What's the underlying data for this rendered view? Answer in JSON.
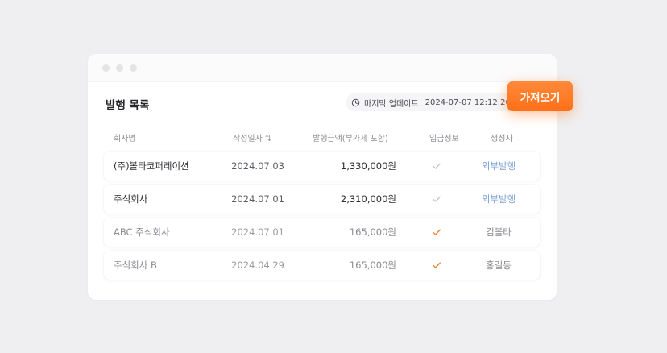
{
  "window": {
    "heading": "발행 목록",
    "last_update_label": "마지막 업데이트",
    "last_update_time": "2024-07-07 12:12:20"
  },
  "columns": {
    "company": "회사명",
    "date": "작성일자",
    "amount": "발행금액(부가세 포함)",
    "deposit": "입금정보",
    "creator": "생성자"
  },
  "rows": [
    {
      "company": "(주)볼타코퍼레이션",
      "date": "2024.07.03",
      "amount": "1,330,000원",
      "deposit_checked": true,
      "creator": "외부발행"
    },
    {
      "company": "주식회사",
      "date": "2024.07.01",
      "amount": "2,310,000원",
      "deposit_checked": true,
      "creator": "외부발행"
    },
    {
      "company": "ABC 주식회사",
      "date": "2024.07.01",
      "amount": "165,000원",
      "deposit_checked": true,
      "creator": "김볼타"
    },
    {
      "company": "주식회사 B",
      "date": "2024.04.29",
      "amount": "165,000원",
      "deposit_checked": true,
      "creator": "홍길동"
    }
  ],
  "fetch_button": {
    "label": "가져오기"
  },
  "colors": {
    "accent": "#ff7a26",
    "check_grey": "#c4c5ca",
    "check_orange": "#f08a3c",
    "link_blue": "#7e9fd6"
  },
  "icons": {
    "clock": "clock-icon",
    "sort": "sort-icon",
    "check": "check-icon"
  }
}
